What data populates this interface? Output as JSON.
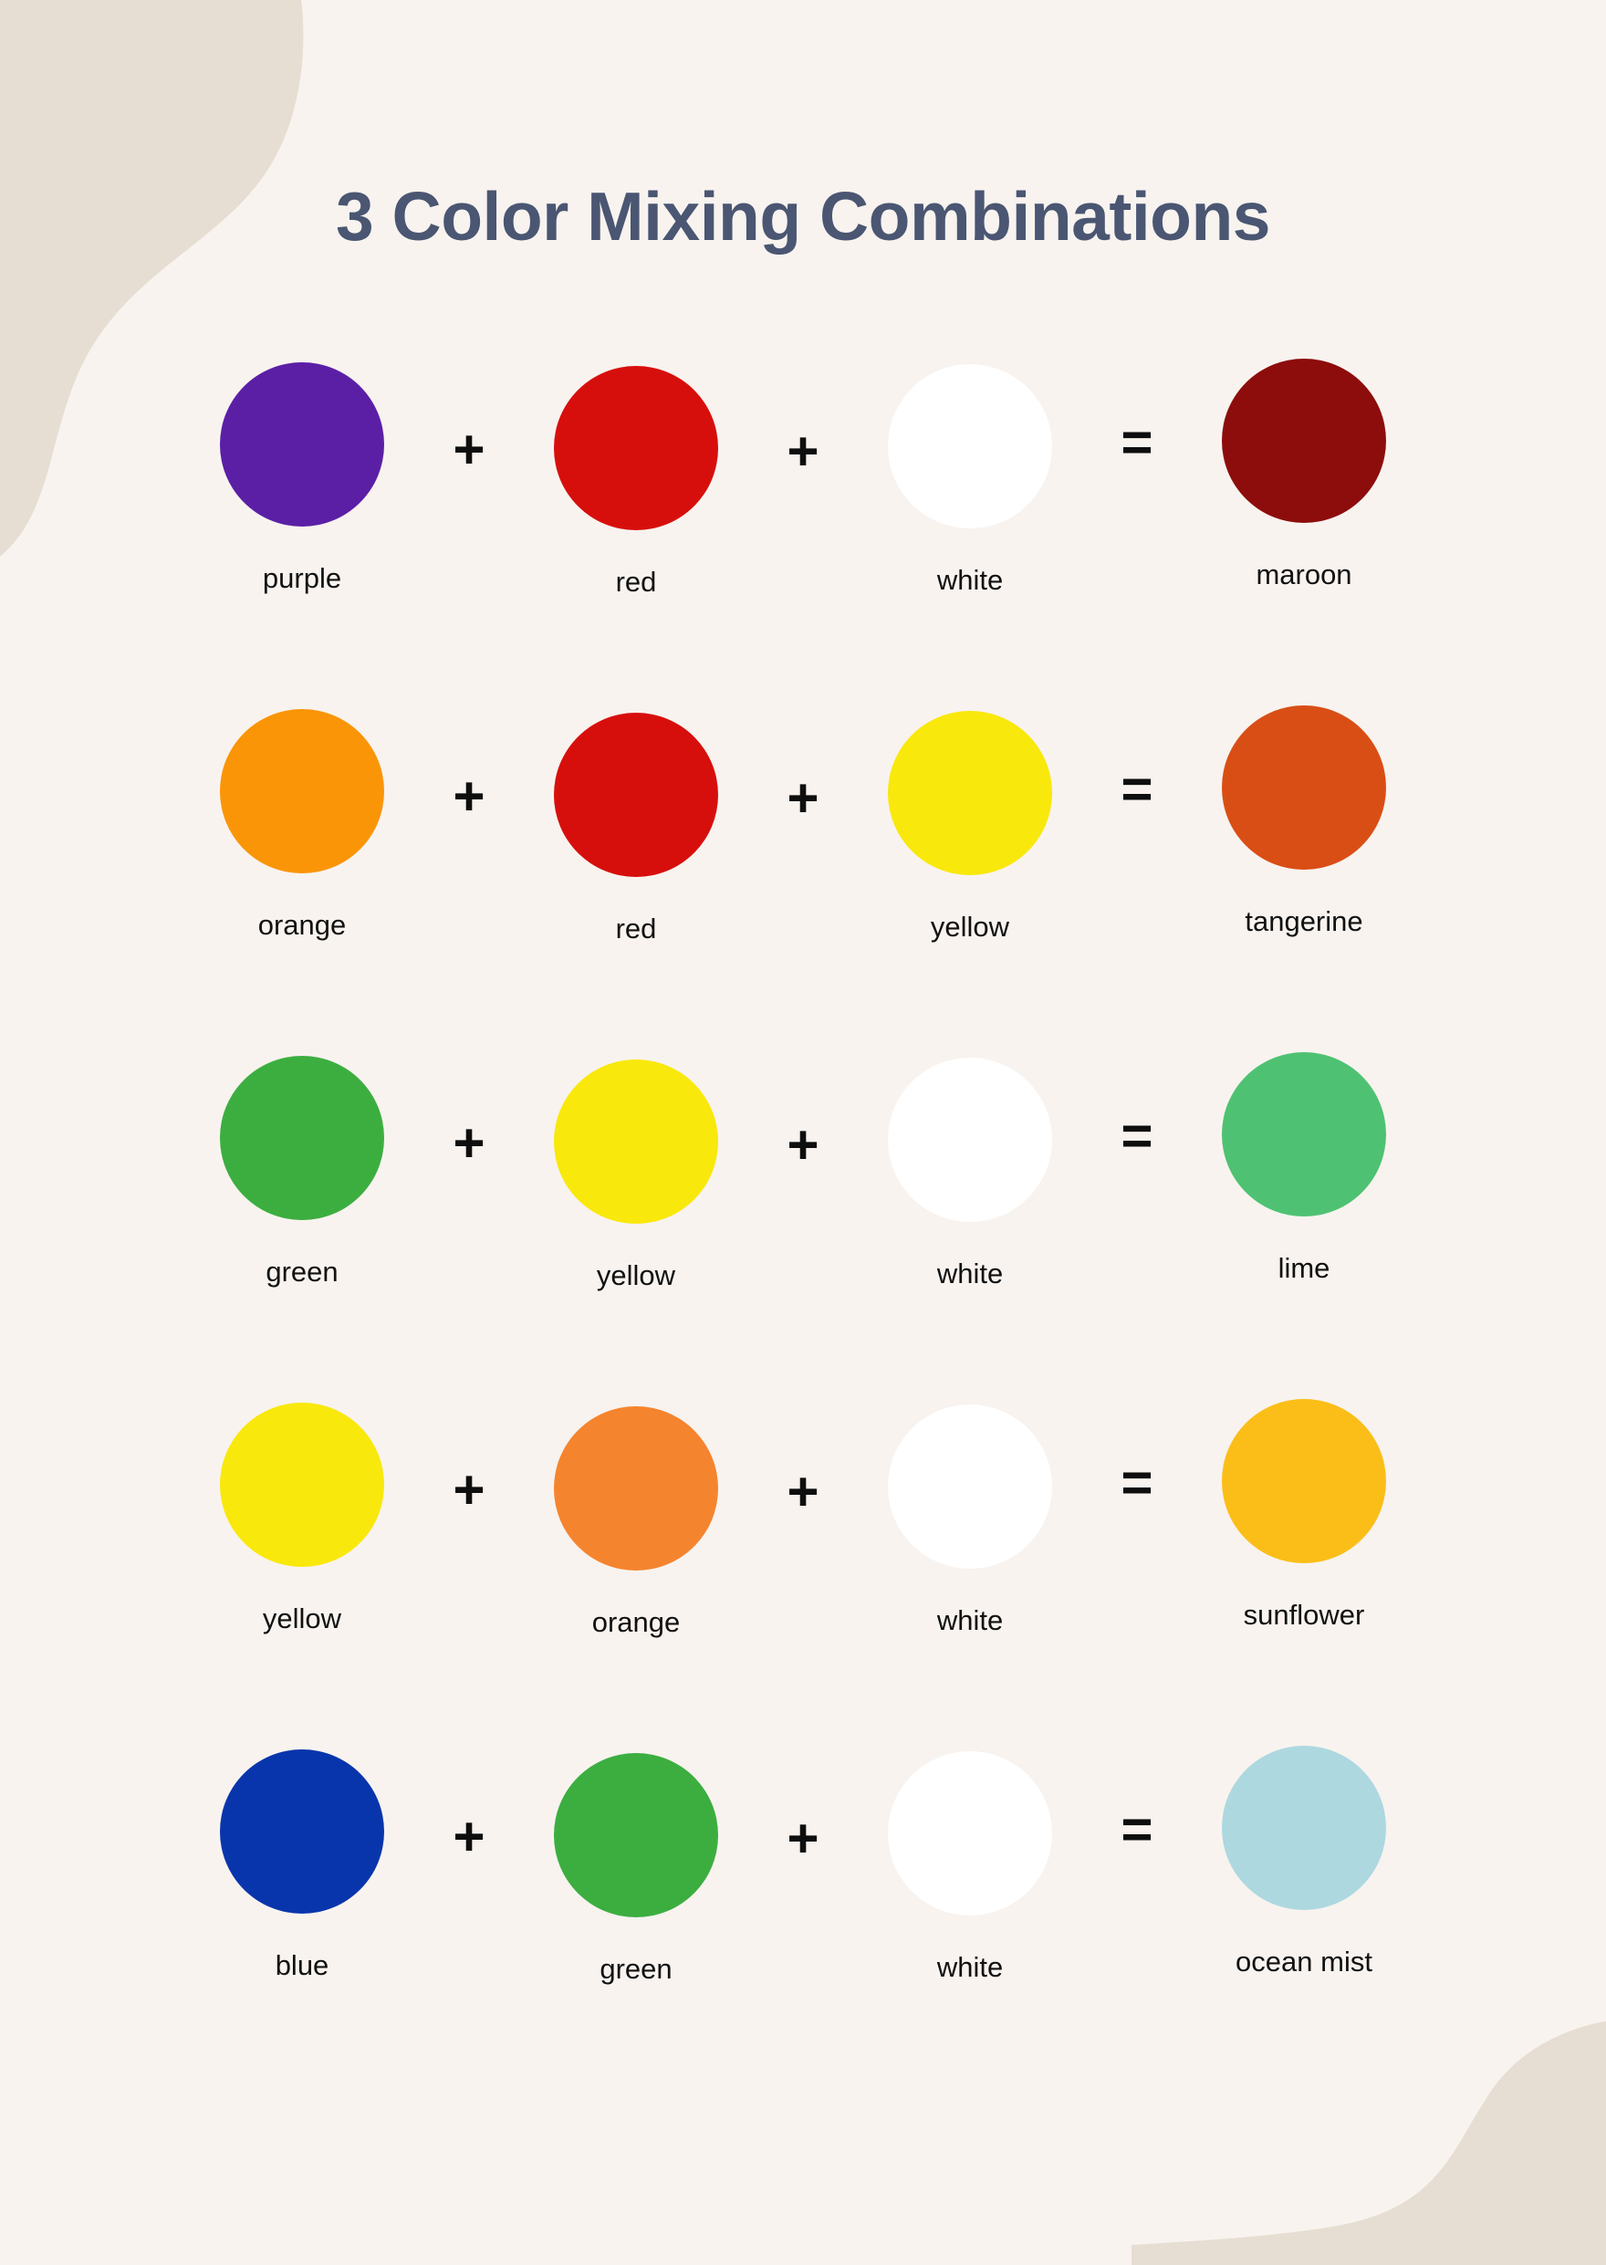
{
  "page": {
    "title": "3 Color Mixing Combinations",
    "background_color": "#F8F3EF",
    "title_color": "#4A5672",
    "decor_color": "#E6DED2",
    "label_color": "#111111",
    "operator_color": "#0E0E0E"
  },
  "operators": {
    "plus": "+",
    "equals": "="
  },
  "rows": [
    {
      "ingredients": [
        {
          "label": "purple",
          "color": "#5B1FA6"
        },
        {
          "label": "red",
          "color": "#D70F0C"
        },
        {
          "label": "white",
          "color": "#FFFFFF"
        }
      ],
      "result": {
        "label": "maroon",
        "color": "#8C0D0C"
      }
    },
    {
      "ingredients": [
        {
          "label": "orange",
          "color": "#FA9508"
        },
        {
          "label": "red",
          "color": "#D70F0C"
        },
        {
          "label": "yellow",
          "color": "#F9E80B"
        }
      ],
      "result": {
        "label": "tangerine",
        "color": "#D94E15"
      }
    },
    {
      "ingredients": [
        {
          "label": "green",
          "color": "#3CAE40"
        },
        {
          "label": "yellow",
          "color": "#F9E80B"
        },
        {
          "label": "white",
          "color": "#FFFFFF"
        }
      ],
      "result": {
        "label": "lime",
        "color": "#4EC272"
      }
    },
    {
      "ingredients": [
        {
          "label": "yellow",
          "color": "#F9E80B"
        },
        {
          "label": "orange",
          "color": "#F5842E"
        },
        {
          "label": "white",
          "color": "#FFFFFF"
        }
      ],
      "result": {
        "label": "sunflower",
        "color": "#FBBE18"
      }
    },
    {
      "ingredients": [
        {
          "label": "blue",
          "color": "#0935AC"
        },
        {
          "label": "green",
          "color": "#3CAE40"
        },
        {
          "label": "white",
          "color": "#FFFFFF"
        }
      ],
      "result": {
        "label": "ocean mist",
        "color": "#ADD8E0"
      }
    }
  ]
}
